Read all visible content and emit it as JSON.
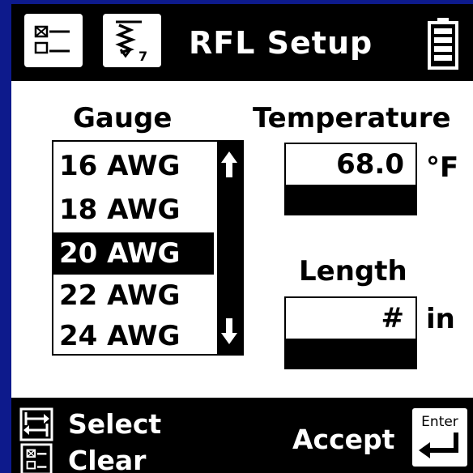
{
  "header": {
    "title": "RFL Setup",
    "menu_icon": "checkbox-list-icon",
    "trace_icon": "waveform-trace-icon",
    "battery_icon": "battery-full-icon"
  },
  "gauge": {
    "label": "Gauge",
    "items": [
      "16 AWG",
      "18 AWG",
      "20 AWG",
      "22 AWG",
      "24 AWG"
    ],
    "selected": "20 AWG",
    "scroll_up_icon": "arrow-up-icon",
    "scroll_down_icon": "arrow-down-icon"
  },
  "temperature": {
    "label": "Temperature",
    "value": "68.0",
    "unit": "°F"
  },
  "length": {
    "label": "Length",
    "value": "#",
    "unit": "in"
  },
  "footer": {
    "select_label": "Select",
    "clear_label": "Clear",
    "accept_label": "Accept",
    "enter_label": "Enter",
    "select_icon": "swap-arrows-icon",
    "clear_icon": "checkbox-list-icon",
    "enter_icon": "enter-key-icon"
  },
  "colors": {
    "bezel": "#0d1a8c",
    "background": "#ffffff",
    "foreground": "#000000"
  }
}
